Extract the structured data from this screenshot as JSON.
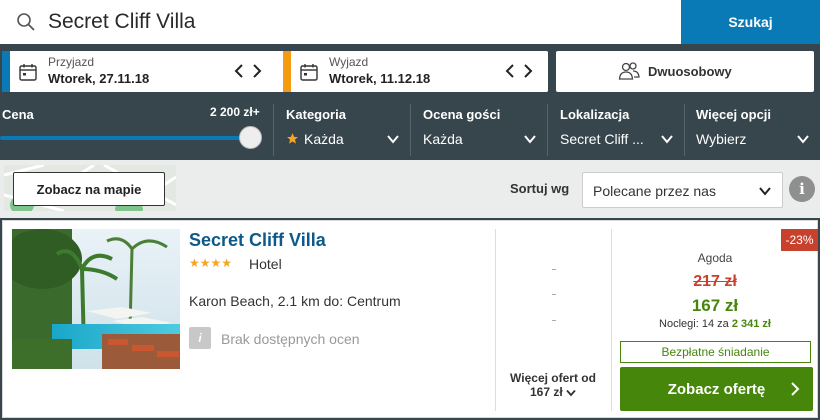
{
  "search": {
    "value": "Secret Cliff Villa",
    "button_label": "Szukaj"
  },
  "dates": {
    "checkin": {
      "label": "Przyjazd",
      "value": "Wtorek, 27.11.18",
      "accent": "#0a7ab6"
    },
    "checkout": {
      "label": "Wyjazd",
      "value": "Wtorek, 11.12.18",
      "accent": "#f39c12"
    }
  },
  "room": {
    "value": "Dwuosobowy"
  },
  "filters": {
    "price": {
      "label": "Cena",
      "max_value": "2 200 zł+",
      "slider_level_fraction": 1.0
    },
    "category": {
      "label": "Kategoria",
      "value": "Każda"
    },
    "guest_rating": {
      "label": "Ocena gości",
      "value": "Każda"
    },
    "location": {
      "label": "Lokalizacja",
      "value": "Secret Cliff ..."
    },
    "more": {
      "label": "Więcej opcji",
      "value": "Wybierz"
    }
  },
  "map": {
    "button_label": "Zobacz na mapie"
  },
  "sort": {
    "label": "Sortuj wg",
    "value": "Polecane przez nas",
    "info_label": "i"
  },
  "result": {
    "name": "Secret Cliff Villa",
    "stars": "★★★★",
    "type": "Hotel",
    "location": "Karon Beach, 2.1 km do: Centrum",
    "rating_icon": "i",
    "rating_text": "Brak dostępnych ocen",
    "more_offers_line1": "Więcej ofert od",
    "more_offers_line2": "167 zł",
    "discount": "-23%",
    "provider": "Agoda",
    "old_price": "217 zł",
    "new_price": "167 zł",
    "nights_prefix": "Noclegi: 14 za",
    "nights_total": "2 341 zł",
    "breakfast": "Bezpłatne śniadanie",
    "cta_label": "Zobacz ofertę"
  },
  "colors": {
    "brand_blue": "#0a7ab6",
    "dark_bar": "#37454d",
    "green": "#46860a",
    "red": "#c8412d"
  }
}
